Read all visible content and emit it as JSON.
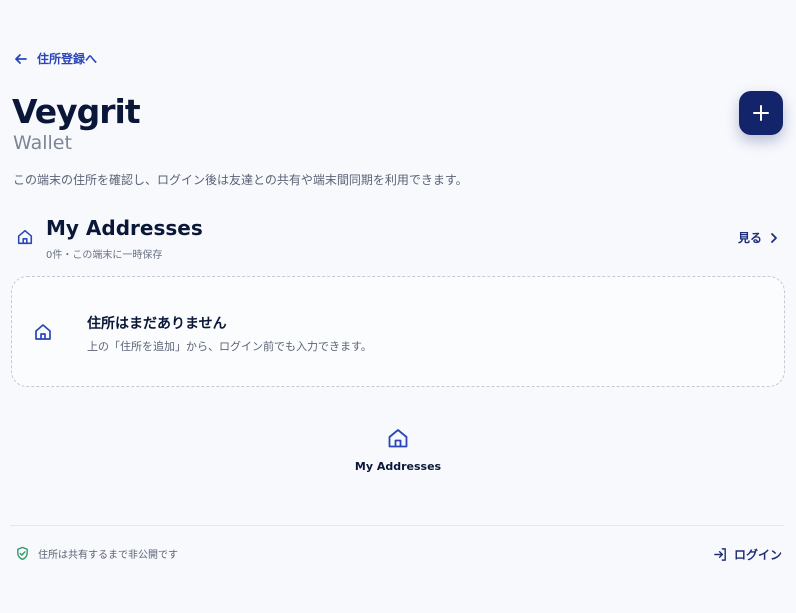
{
  "nav": {
    "back_label": "住所登録へ"
  },
  "brand": {
    "title": "Veygrit",
    "subtitle": "Wallet"
  },
  "description": "この端末の住所を確認し、ログイン後は友達との共有や端末間同期を利用できます。",
  "section": {
    "title": "My Addresses",
    "meta": "0件・この端末に一時保存",
    "view_label": "見る"
  },
  "empty_state": {
    "title": "住所はまだありません",
    "text": "上の「住所を追加」から、ログイン前でも入力できます。"
  },
  "center_nav": {
    "label": "My Addresses"
  },
  "footer": {
    "privacy_text": "住所は共有するまで非公開です",
    "login_label": "ログイン"
  },
  "colors": {
    "accent": "#2a45b8",
    "primary_dark": "#14246b",
    "privacy_icon": "#2f9a67",
    "background": "#f7f9fd"
  },
  "icons": {
    "back": "arrow-left-icon",
    "add": "plus-icon",
    "section": "home-icon",
    "view": "chevron-right-icon",
    "privacy": "shield-check-icon",
    "login": "login-icon"
  }
}
